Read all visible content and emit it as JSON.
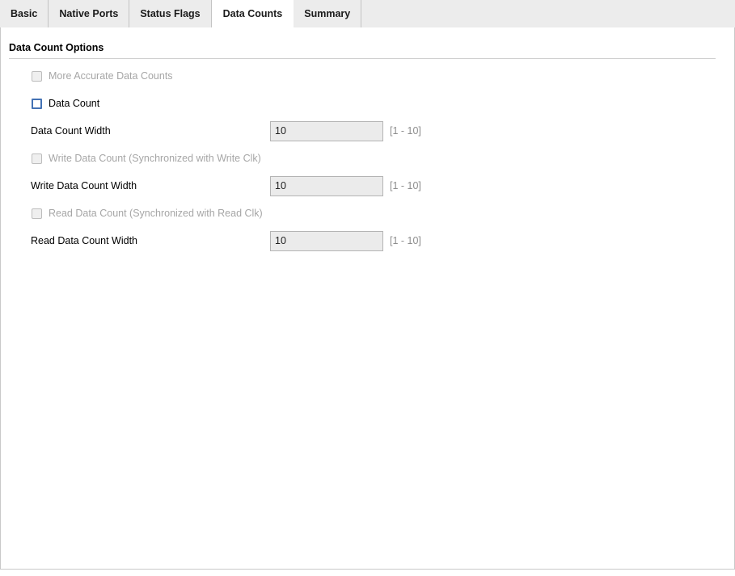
{
  "tabs": [
    {
      "label": "Basic",
      "active": false
    },
    {
      "label": "Native Ports",
      "active": false
    },
    {
      "label": "Status Flags",
      "active": false
    },
    {
      "label": "Data Counts",
      "active": true
    },
    {
      "label": "Summary",
      "active": false
    }
  ],
  "panel": {
    "section_title": "Data Count Options",
    "checkboxes": [
      {
        "label": "More Accurate Data Counts",
        "checked": false,
        "enabled": false
      },
      {
        "label": "Data Count",
        "checked": false,
        "enabled": true
      },
      {
        "label": "Write Data Count (Synchronized with Write Clk)",
        "checked": false,
        "enabled": false
      },
      {
        "label": "Read Data Count (Synchronized with Read Clk)",
        "checked": false,
        "enabled": false
      }
    ],
    "fields": [
      {
        "label": "Data Count Width",
        "value": "10",
        "hint": "[1 - 10]"
      },
      {
        "label": "Write Data Count Width",
        "value": "10",
        "hint": "[1 - 10]"
      },
      {
        "label": "Read Data Count Width",
        "value": "10",
        "hint": "[1 - 10]"
      }
    ]
  },
  "colors": {
    "accent": "#4472b4",
    "tabstrip_bg": "#ececec",
    "disabled_text": "#a6a6a6",
    "hint_text": "#8d8d8d",
    "input_bg": "#ebebeb"
  }
}
